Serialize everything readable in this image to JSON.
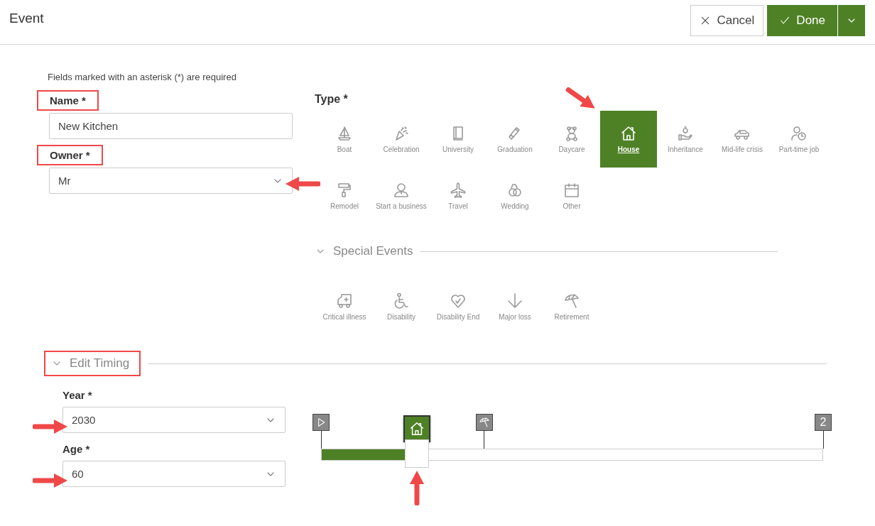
{
  "header": {
    "title": "Event",
    "buttons": [
      {
        "kind": "cancel",
        "label": "Cancel"
      },
      {
        "kind": "done",
        "label": "Done"
      },
      {
        "kind": "menu"
      }
    ]
  },
  "note": "Fields marked with an asterisk (*) are required",
  "fields": [
    {
      "label": "Name *",
      "kind": "text",
      "value": "New Kitchen",
      "framed": true
    },
    {
      "label": "Owner *",
      "kind": "select",
      "value": "Mr",
      "framed": true,
      "pointed": true
    }
  ],
  "type": {
    "label": "Type *",
    "items": [
      {
        "kind": "boat",
        "label": "Boat",
        "selected": false
      },
      {
        "kind": "celebration",
        "label": "Celebration",
        "selected": false
      },
      {
        "kind": "book",
        "label": "University",
        "selected": false
      },
      {
        "kind": "diploma",
        "label": "Graduation",
        "selected": false
      },
      {
        "kind": "bear",
        "label": "Daycare",
        "selected": false
      },
      {
        "kind": "house",
        "label": "House",
        "selected": true,
        "pointed": true
      },
      {
        "kind": "hand",
        "label": "Inheritance",
        "selected": false
      },
      {
        "kind": "car",
        "label": "Mid-life crisis",
        "selected": false
      },
      {
        "kind": "clock",
        "label": "Part-time job",
        "selected": false
      },
      {
        "kind": "roller",
        "label": "Remodel",
        "selected": false
      },
      {
        "kind": "person",
        "label": "Start a business",
        "selected": false
      },
      {
        "kind": "plane",
        "label": "Travel",
        "selected": false
      },
      {
        "kind": "rings",
        "label": "Wedding",
        "selected": false
      },
      {
        "kind": "calendar",
        "label": "Other",
        "selected": false
      }
    ]
  },
  "special": {
    "title": "Special Events",
    "expanded": true,
    "items": [
      {
        "kind": "ambulance",
        "label": "Critical illness",
        "selected": false
      },
      {
        "kind": "wheelchair",
        "label": "Disability",
        "selected": false
      },
      {
        "kind": "heart",
        "label": "Disability End",
        "selected": false
      },
      {
        "kind": "down",
        "label": "Major loss",
        "selected": false
      },
      {
        "kind": "umbrella",
        "label": "Retirement",
        "selected": false
      }
    ]
  },
  "timing": {
    "title": "Edit Timing",
    "expanded": true,
    "framed": true,
    "fields": [
      {
        "label": "Year *",
        "value": "2030",
        "pointed": true
      },
      {
        "label": "Age *",
        "value": "60",
        "pointed": true
      }
    ],
    "slider": {
      "level": 0.167,
      "pointed": true
    },
    "markers": [
      {
        "kind": "start"
      },
      {
        "kind": "event"
      },
      {
        "kind": "retirement"
      },
      {
        "kind": "count",
        "text": "2"
      }
    ]
  }
}
